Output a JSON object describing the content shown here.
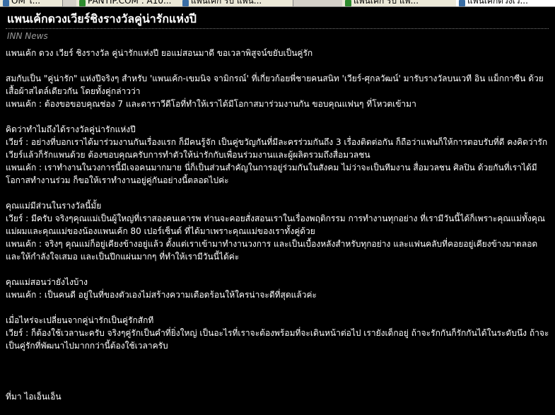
{
  "browser": {
    "tabs": [
      {
        "label": "OM ไ...",
        "favicon_color": "#3a6ea5",
        "active": false
      },
      {
        "label": "PANTIP.COM : A10...",
        "favicon_color": "#2e8b2e",
        "active": false
      },
      {
        "label": "แพนเค้ก รบ แพน...",
        "favicon_color": "#3a6ea5",
        "active": false
      },
      {
        "label": "แพนเค้ก รบ แพ...",
        "favicon_color": "#2e8b2e",
        "active": false
      },
      {
        "label": "แพนเค้กดวงเว...",
        "favicon_color": "#3a6ea5",
        "active": true
      }
    ]
  },
  "article": {
    "headline": "แพนเค้กดวงเวียร์ชิงรางวัลคู่น่ารักแห่งปี",
    "source": "INN News",
    "paragraphs": [
      [
        "แพนเค้ก ดวง เวียร์ ชิงรางวัล คู่น่ารักแห่งปี ยอแม่สอนมาดี ขอเวลาพิสูจน์ขยับเป็นคู่รัก"
      ],
      [
        "สมกับเป็น \"คู่น่ารัก\" แห่งปีจริงๆ สำหรับ 'แพนเค้ก-เขมนิจ จามิกรณ์' ที่เกี่ยวก้อยพี่ชายคนสนิท 'เวียร์-ศุกลวัฒน์' มารับรางวัลบนเวที อิน แม็กกาซีน ด้วยเสื้อผ้าสไตล์เดียวกัน โดยทั้งคู่กล่าวว่า",
        "แพนเค้ก : ต้องขอขอบคุณช่อง 7 และดาราวีดีโอที่ทำให้เราได้มีโอกาสมาร่วมงานกัน ขอบคุณแฟนๆ ที่โหวตเข้ามา"
      ],
      [
        "คิดว่าทำไมถึงได้รางวัลคู่น่ารักแห่งปี",
        "เวียร์ : อย่างที่บอกเราได้มาร่วมงานกันเรื่องแรก ก็มีคนรู้จัก เป็นคู่ขวัญกันที่มีละครร่วมกันถึง 3 เรื่องติดต่อกัน ก็ถือว่าแฟนก็ให้การตอบรับที่ดี คงคิดว่ารักเวียร์แล้วก็รักแพนด้วย ต้องขอบคุณครับการทำตัวให้น่ารักกับเพื่อนร่วมงานและผู้ผลิตรวมถึงสื่อมวลชน",
        "แพนเค้ก : เราทำงานในวงการนี้มีเจอคนมากมาย นี่ก็เป็นส่วนสำคัญในการอยู่ร่วมกันในสังคม ไม่ว่าจะเป็นทีมงาน สื่อมวลชน ศิลปิน ด้วยกันที่เราได้มีโอกาสทำงานร่วม ก็ขอให้เราทำงานอยู่คู่กันอย่างนี้ตลอดไปค่ะ"
      ],
      [
        "คุณแม่มีส่วนในรางวัลนี้มั้ย",
        "เวียร์ : มีครับ จริงๆคุณแม่เป็นผู้ใหญ่ที่เราสองคนเคารพ ท่านจะคอยสั่งสอนเราในเรื่องพฤติกรรม การทำงานทุกอย่าง ที่เรามีวันนี้ได้ก็เพราะคุณแม่ทั้งคุณแม่ผมและคุณแม่ของน้องแพนเค้ก 80 เปอร์เซ็นต์ ที่ได้มาเพราะคุณแม่ของเราทั้งคู่ด้วย",
        "แพนเค้ก : จริงๆ คุณแม่ก็อยู่เคียงข้างอยู่แล้ว ตั้งแต่เราเข้ามาทำงานวงการ และเป็นเบื้องหลังสำหรับทุกอย่าง และแฟนคลับที่คอยอยู่เคียงข้างมาตลอดและให้กำลังใจเสมอ และเป็นปีกแผ่นมากๆ ที่ทำให้เรามีวันนี้ได้ค่ะ"
      ],
      [
        "คุณแม่สอนว่ายังไงบ้าง",
        "แพนเค้ก : เป็นคนดี อยู่ในที่ของตัวเองไม่สร้างความเดือดร้อนให้ใครน่าจะดีที่สุดแล้วค่ะ"
      ],
      [
        "เมื่อไหร่จะเปลี่ยนจากคู่น่ารักเป็นคู่รักสักที",
        "เวียร์ : ก็ต้องใช้เวลานะครับ จริงๆคู่รักเป็นคำที่ยิ่งใหญ่ เป็นอะไรที่เราจะต้องพร้อมที่จะเดินหน้าต่อไป เรายังเด็กอยู่ ถ้าจะรักกันก็รักกันได้ในระดับนึง ถ้าจะเป็นคู่รักที่พัฒนาไปมากกว่านี้ต้องใช้เวลาครับ"
      ]
    ],
    "footer": "ที่มา ไอเอ็นเอ็น"
  },
  "colors": {
    "background": "#000000",
    "text": "#ffffff",
    "source": "#999999"
  }
}
